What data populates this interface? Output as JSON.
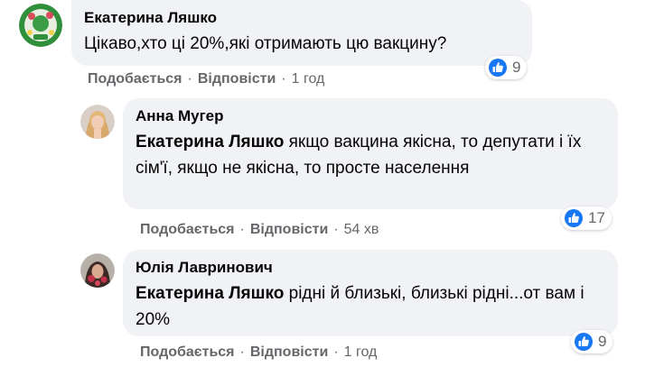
{
  "comments": [
    {
      "author": "Екатерина Ляшко",
      "text": "Цікаво,хто ці 20%,які отримають цю вакцину?",
      "like_label": "Подобається",
      "reply_label": "Відповісти",
      "time": "1 год",
      "reactions": {
        "icon": "like-icon",
        "count": "9",
        "color": "#1877f2"
      }
    },
    {
      "author": "Анна Мугер",
      "mention": "Екатерина Ляшко",
      "text": " якщо вакцина якісна, то депутати і їх сім'ї, якщо не якісна, то просте населення",
      "like_label": "Подобається",
      "reply_label": "Відповісти",
      "time": "54 хв",
      "reactions": {
        "icon": "like-icon",
        "count": "17",
        "color": "#1877f2"
      }
    },
    {
      "author": "Юлія Лавринович",
      "mention": "Екатерина Ляшко",
      "text": " рідні й близькі, близькі рідні...от вам і 20%",
      "like_label": "Подобається",
      "reply_label": "Відповісти",
      "time": "1 год",
      "reactions": {
        "icon": "like-icon",
        "count": "9",
        "color": "#1877f2"
      }
    }
  ],
  "separator": "·"
}
